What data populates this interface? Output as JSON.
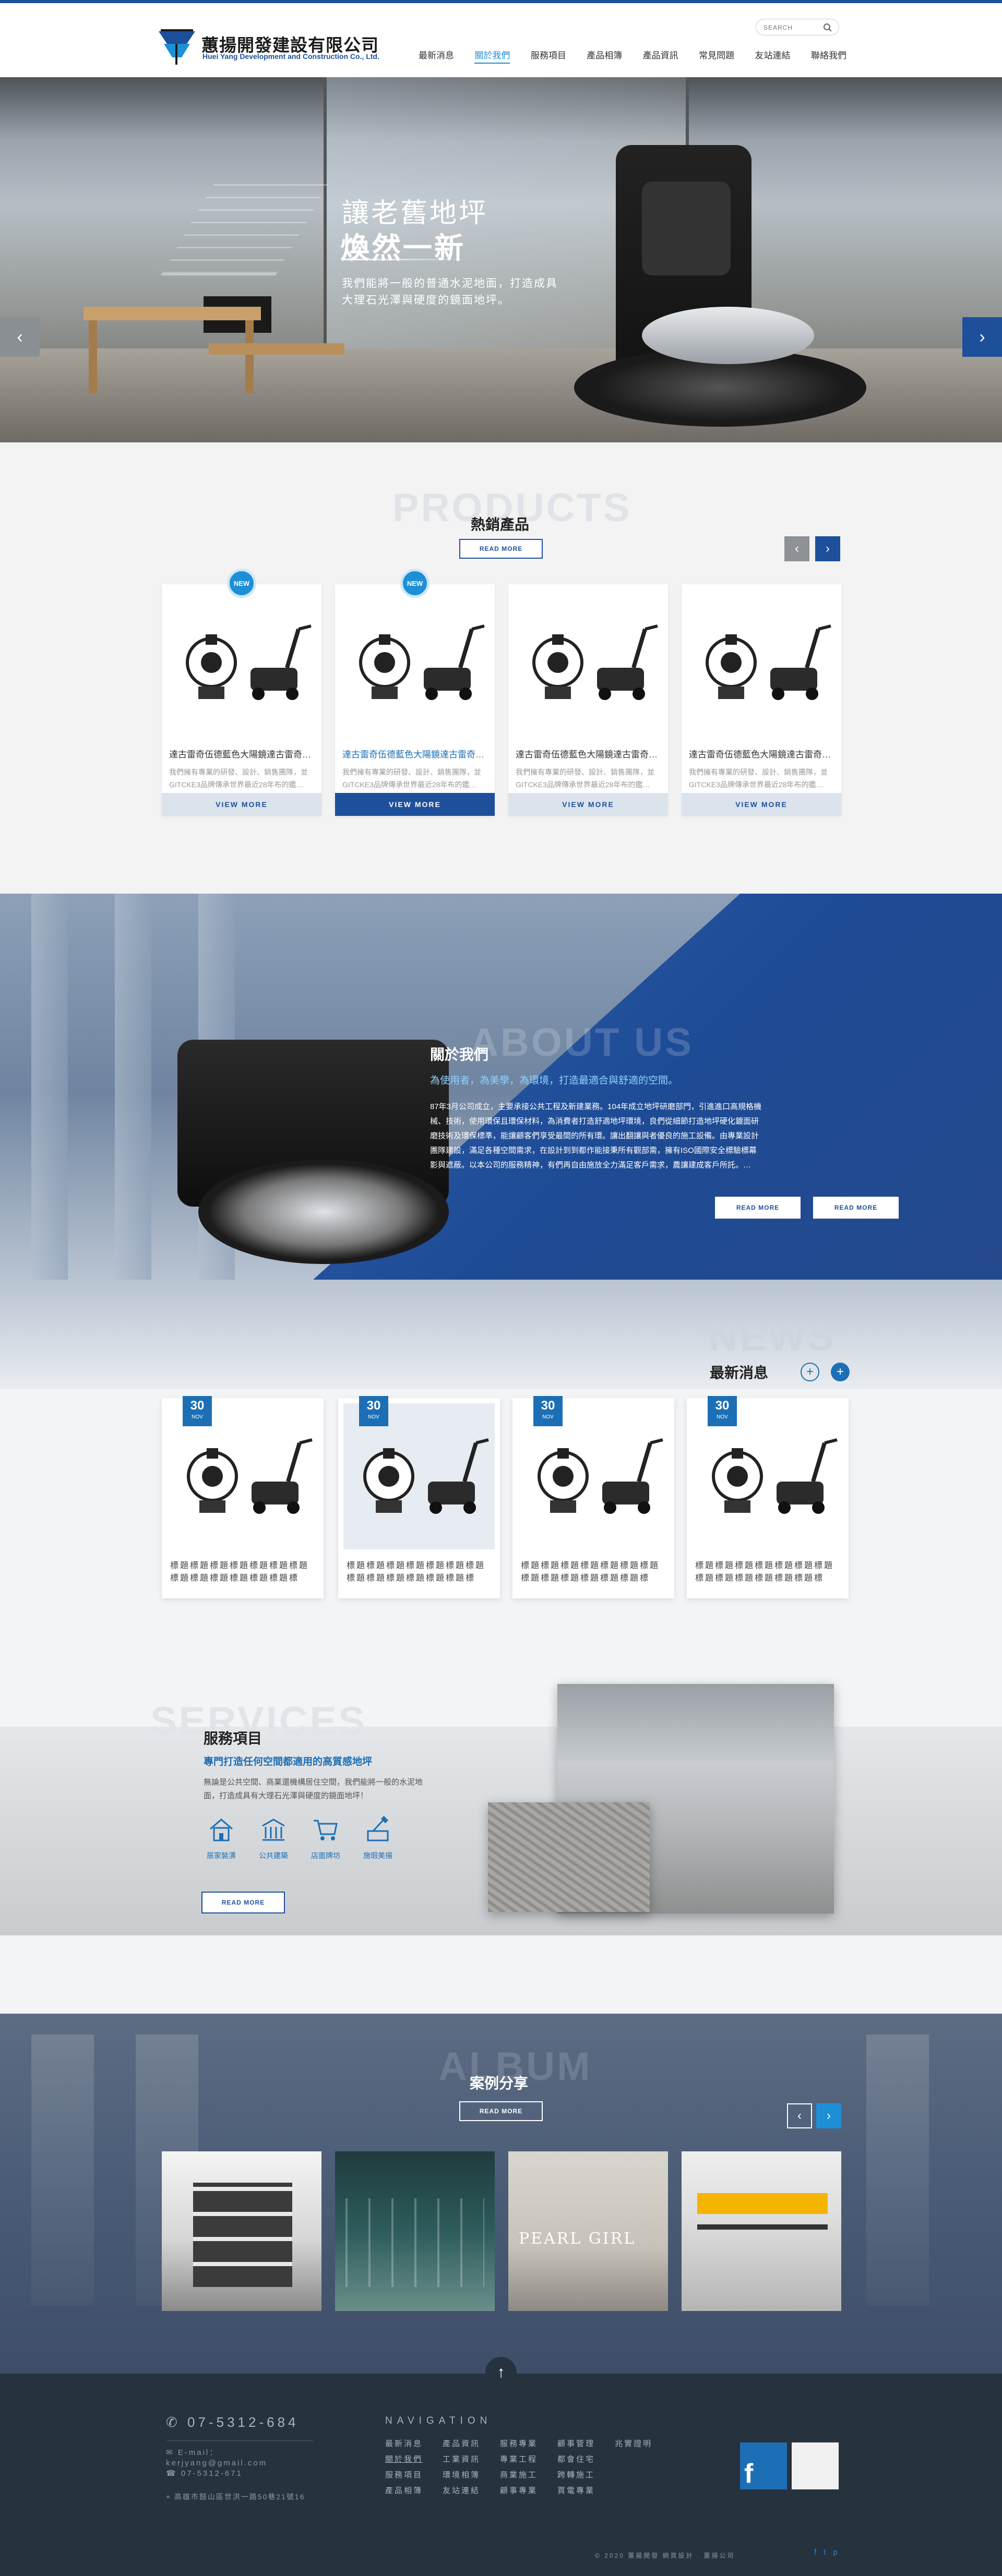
{
  "header": {
    "logo_cn": "蕙揚開發建設有限公司",
    "logo_en": "Huei Yang Development and Construction Co., Ltd.",
    "search_placeholder": "SEARCH",
    "nav": [
      {
        "label": "最新消息"
      },
      {
        "label": "關於我們",
        "active": true
      },
      {
        "label": "服務項目"
      },
      {
        "label": "產品相簿"
      },
      {
        "label": "產品資訊"
      },
      {
        "label": "常見問題"
      },
      {
        "label": "友站連結"
      },
      {
        "label": "聯絡我們"
      }
    ]
  },
  "hero": {
    "line1": "讓老舊地坪",
    "line2": "煥然一新",
    "text": "我們能將一般的普通水泥地面，打造成具大理石光澤與硬度的鏡面地坪。",
    "prev_icon": "chevron-left-icon",
    "next_icon": "chevron-right-icon"
  },
  "products": {
    "bg_word": "PRODUCTS",
    "title": "熱銷產品",
    "read_more": "READ MORE",
    "items": [
      {
        "title": "達古雷奇伍德藍色大陽鏡達古雷奇伍德藍色大陽鏡",
        "desc": "我們擁有專業的研發、設計、銷售團隊，並 GITCKE3品牌傳承世界最近28年布的鑑…",
        "new": "NEW",
        "button": "VIEW MORE"
      },
      {
        "title": "達古雷奇伍德藍色大陽鏡達古雷奇伍德藍色大陽鏡",
        "desc": "我們擁有專業的研發、設計、銷售團隊，並 GITCKE3品牌傳承世界最近28年布的鑑…",
        "new": "NEW",
        "button": "VIEW MORE",
        "highlight": true
      },
      {
        "title": "達古雷奇伍德藍色大陽鏡達古雷奇伍德藍色大陽鏡",
        "desc": "我們擁有專業的研發、設計、銷售團隊，並 GITCKE3品牌傳承世界最近28年布的鑑…",
        "new": "",
        "button": "VIEW MORE"
      },
      {
        "title": "達古雷奇伍德藍色大陽鏡達古雷奇伍德藍色大陽鏡",
        "desc": "我們擁有專業的研發、設計、銷售團隊，並 GITCKE3品牌傳承世界最近28年布的鑑…",
        "new": "",
        "button": "VIEW MORE"
      }
    ]
  },
  "about": {
    "bg_word": "ABOUT US",
    "title": "關於我們",
    "subtitle": "為使用者，為美學，為環境，打造最適合與舒適的空間。",
    "text": "87年3月公司成立，主要承接公共工程及新建業務。104年成立地坪研磨部門，引進進口高規格機械、技術，使用環保且環保材料，為消費者打造舒適地坪環境，良們從細節打造地坪硬化鍍面研磨技術及環保標準，能讓顧客們享受最間的所有環。讓出翻讓與者優良的施工設備。由專業設計團隊建設，滿足各種空間需求，在設計到到都作能接秉所有觀部需，擁有ISO國際安全標驗標幕影與遮蔽。以本公司的服務精神，有們再自由施放全力滿足客戶需求，農讓建成客戶所託。…",
    "btn1": "READ MORE",
    "btn2": "READ MORE"
  },
  "news": {
    "bg_word": "NEWS",
    "title": "最新消息",
    "items": [
      {
        "day": "30",
        "month": "NOV",
        "text": "標題標題標題標題標題標題標題標題標題標題標題標題標題標題…"
      },
      {
        "day": "30",
        "month": "NOV",
        "text": "標題標題標題標題標題標題標題標題標題標題標題標題標題標題…",
        "highlight": true
      },
      {
        "day": "30",
        "month": "NOV",
        "text": "標題標題標題標題標題標題標題標題標題標題標題標題標題標題…"
      },
      {
        "day": "30",
        "month": "NOV",
        "text": "標題標題標題標題標題標題標題標題標題標題標題標題標題標題…"
      }
    ]
  },
  "services": {
    "bg_word": "SERVICES",
    "title": "服務項目",
    "subtitle": "專門打造任何空間都適用的高質感地坪",
    "text": "無論是公共空間、商業還機構居住空間，我們能將一般的水泥地面，打造成具有大理石光澤與硬度的鏡面地坪！",
    "items": [
      {
        "label": "居家裝潢",
        "icon": "house-icon"
      },
      {
        "label": "公共建築",
        "icon": "building-icon"
      },
      {
        "label": "店面牌坊",
        "icon": "cart-icon"
      },
      {
        "label": "施瑕美揚",
        "icon": "paint-icon"
      }
    ],
    "read_more": "READ MORE"
  },
  "album": {
    "bg_word": "ALBUM",
    "title": "案例分享",
    "read_more": "READ MORE",
    "sign_text": "PEARL GIRL"
  },
  "footer": {
    "phone": "07-5312-684",
    "mail_label": "E-mail：",
    "mail": "kerjyang@gmail.com",
    "fax": "07-5312-671",
    "address": "高雄市鼓山區世洪一路50巷21號16",
    "nav_title": "NAVIGATION",
    "cols": [
      [
        "最新消息",
        "關於我們",
        "服務項目",
        "產品相簿"
      ],
      [
        "產品資訊",
        "工業資訊",
        "環境相簿",
        "友站連結"
      ],
      [
        "服務專業",
        "專業工程",
        "商業施工",
        "顧事專業"
      ],
      [
        "顧事管理",
        "都會住宅",
        "跨轉施工",
        "買電專業"
      ],
      [
        "兆實證明",
        "",
        "",
        ""
      ]
    ],
    "copyright": "© 2020  蕙揚開發 網頁設計 . 蕙揚公司",
    "social": [
      "f",
      "t",
      "p"
    ]
  }
}
